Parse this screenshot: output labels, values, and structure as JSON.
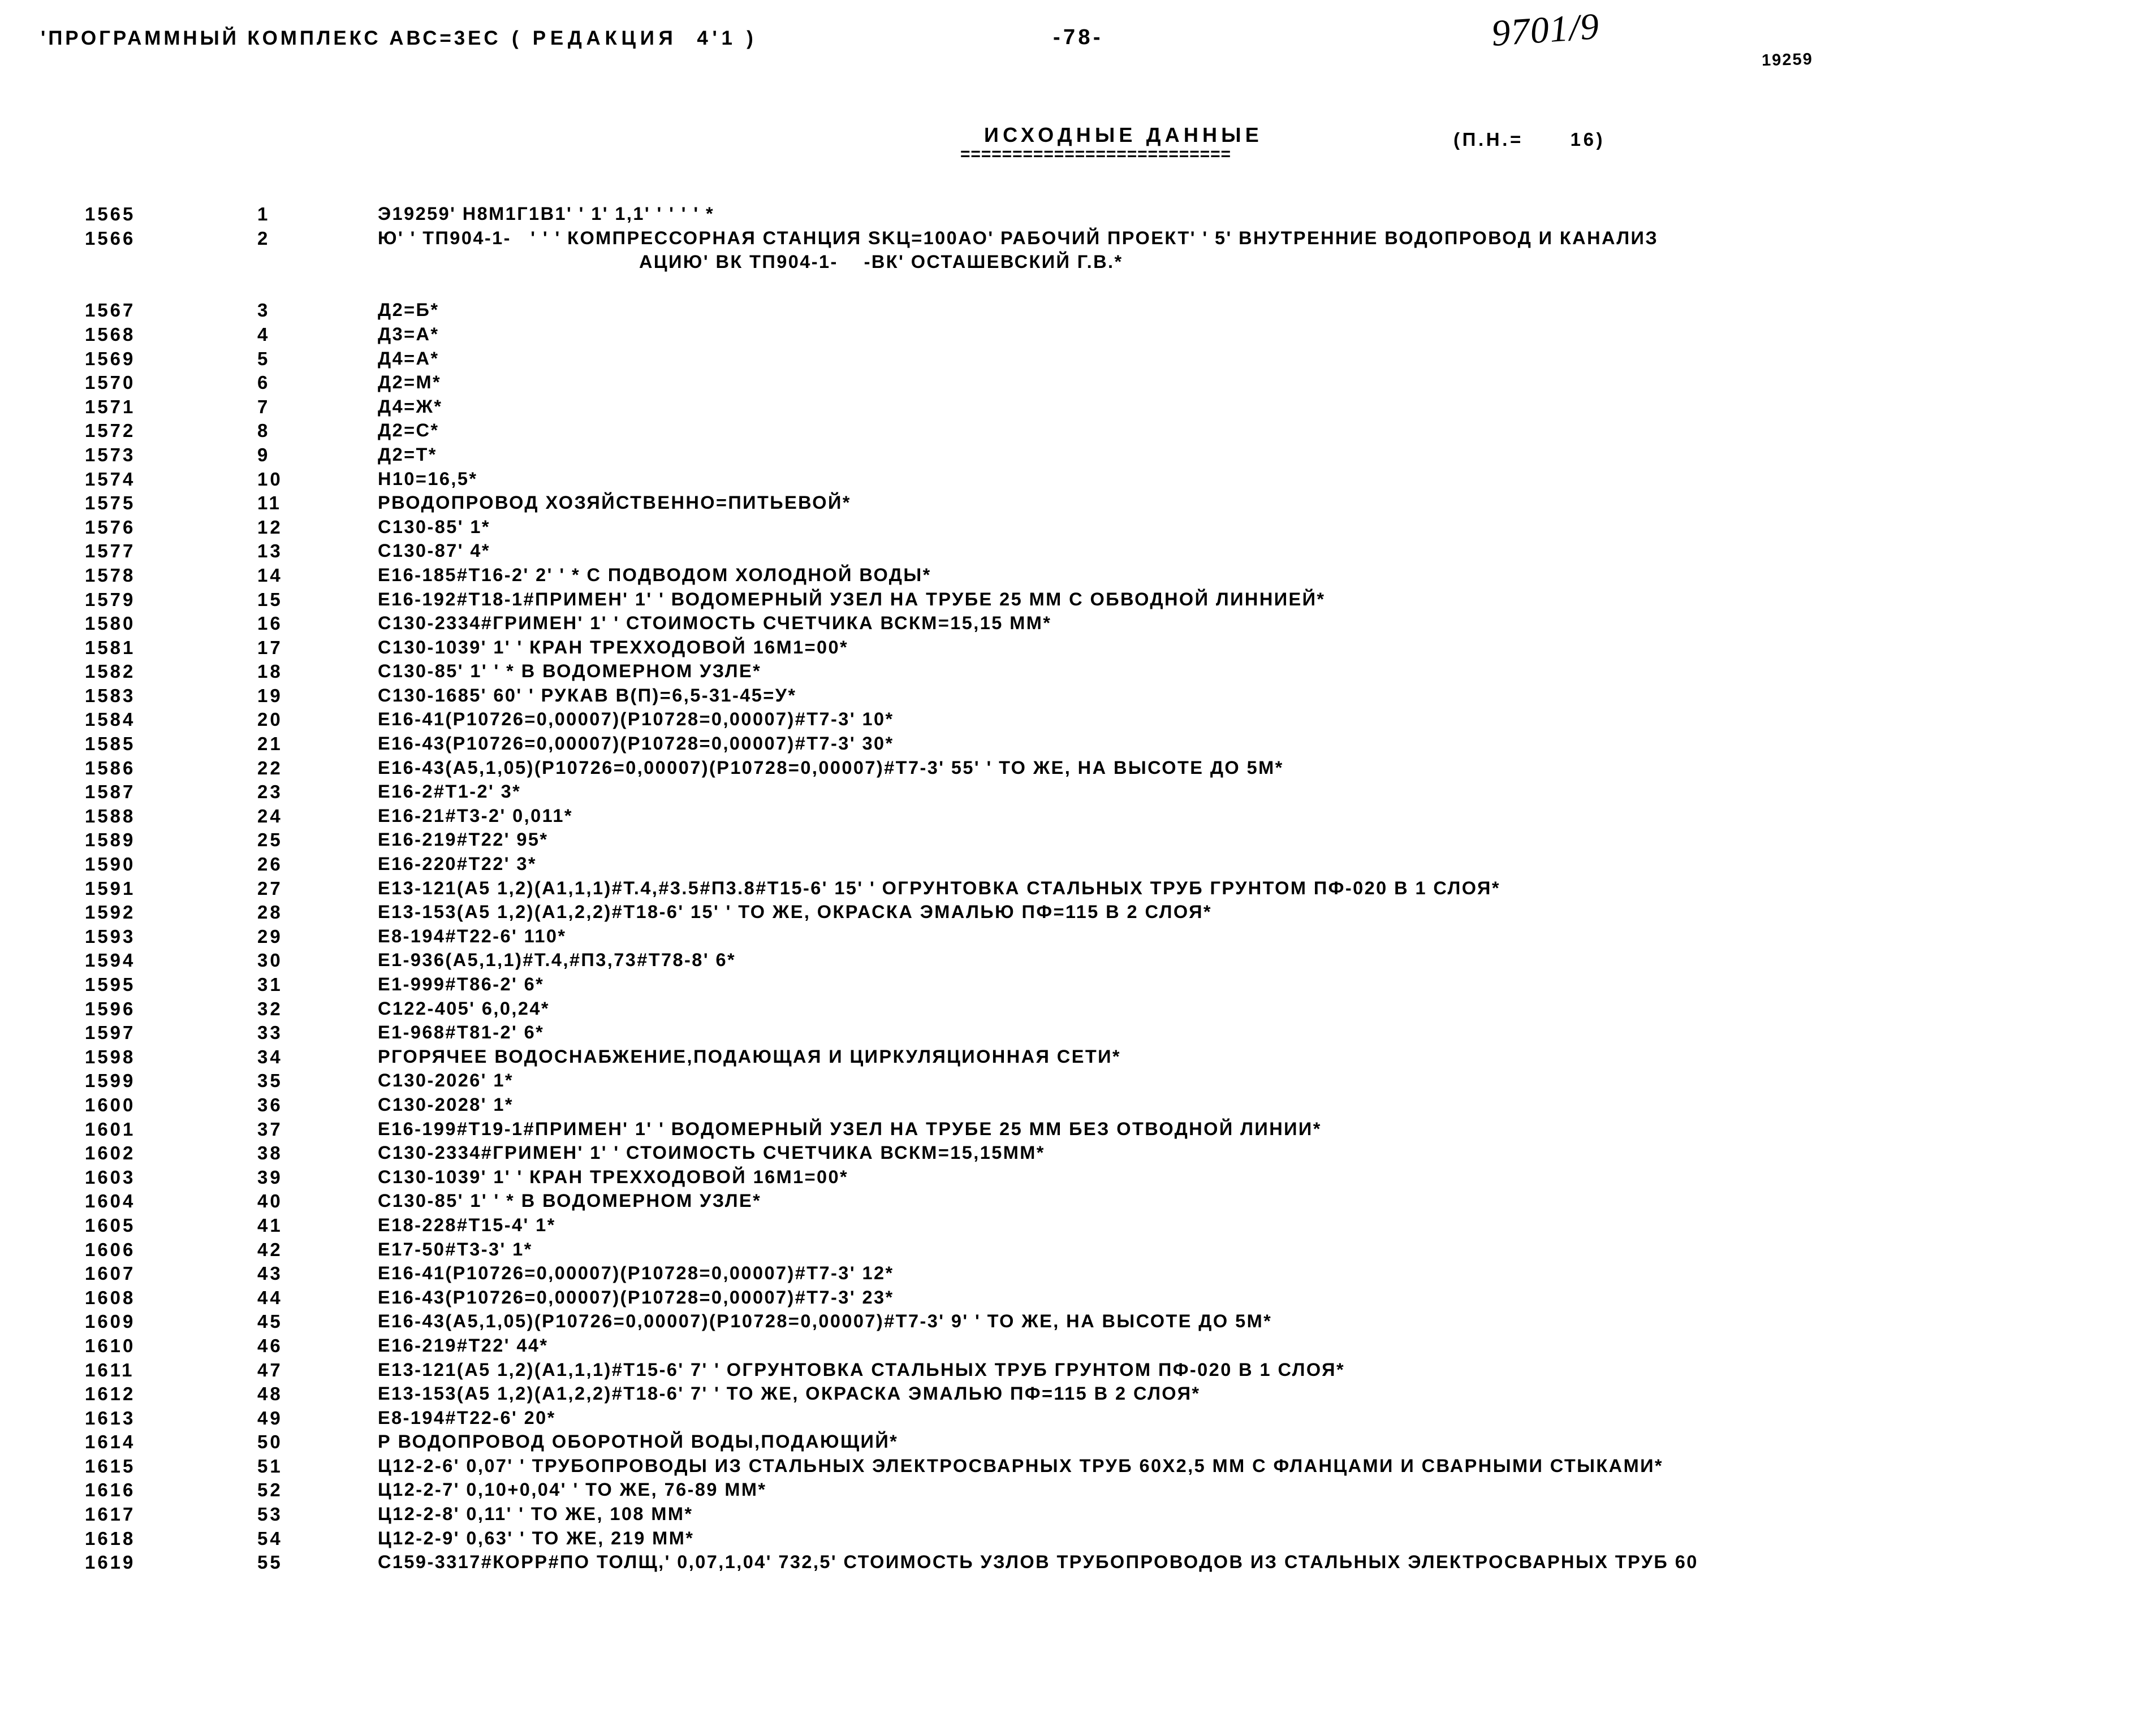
{
  "header": {
    "program_title": "'ПРОГРАММНЫЙ КОМПЛЕКС АВС=3ЕС",
    "revision": "( РЕДАКЦИЯ  4'1 )",
    "page_number": "-78-",
    "order_number": "9701/9",
    "object_stamp": "19259"
  },
  "section": {
    "title": "ИСХОДНЫЕ ДАННЫЕ",
    "rule": "==========================",
    "note": "(П.Н.=      16)"
  },
  "listing": {
    "rows": [
      {
        "recno": "1565",
        "seq": "1",
        "text": "Э19259' Н8М1Г1В1' ' 1' 1,1' ' ' ' ' *",
        "cont": false
      },
      {
        "recno": "1566",
        "seq": "2",
        "text": "Ю' ' ТП904-1-   ' ' ' КОМПРЕССОРНАЯ СТАНЦИЯ SKЦ=100АО' РАБОЧИЙ ПРОЕКТ' ' 5' ВНУТРЕННИЕ ВОДОПРОВОД И КАНАЛИЗ",
        "cont": false
      },
      {
        "recno": "",
        "seq": "",
        "text": "АЦИЮ' ВК ТП904-1-    -ВК' ОСТАШЕВСКИЙ Г.В.*",
        "cont": true
      },
      {
        "recno": "1567",
        "seq": "3",
        "text": "Д2=Б*",
        "cont": false
      },
      {
        "recno": "1568",
        "seq": "4",
        "text": "Д3=А*",
        "cont": false
      },
      {
        "recno": "1569",
        "seq": "5",
        "text": "Д4=А*",
        "cont": false
      },
      {
        "recno": "1570",
        "seq": "6",
        "text": "Д2=М*",
        "cont": false
      },
      {
        "recno": "1571",
        "seq": "7",
        "text": "Д4=Ж*",
        "cont": false
      },
      {
        "recno": "1572",
        "seq": "8",
        "text": "Д2=С*",
        "cont": false
      },
      {
        "recno": "1573",
        "seq": "9",
        "text": "Д2=Т*",
        "cont": false
      },
      {
        "recno": "1574",
        "seq": "10",
        "text": "Н10=16,5*",
        "cont": false
      },
      {
        "recno": "1575",
        "seq": "11",
        "text": "РВОДОПРОВОД ХОЗЯЙСТВЕННО=ПИТЬЕВОЙ*",
        "cont": false
      },
      {
        "recno": "1576",
        "seq": "12",
        "text": "С130-85' 1*",
        "cont": false
      },
      {
        "recno": "1577",
        "seq": "13",
        "text": "С130-87' 4*",
        "cont": false
      },
      {
        "recno": "1578",
        "seq": "14",
        "text": "Е16-185#Т16-2' 2' ' * С ПОДВОДОМ ХОЛОДНОЙ ВОДЫ*",
        "cont": false
      },
      {
        "recno": "1579",
        "seq": "15",
        "text": "Е16-192#Т18-1#ПРИМЕН' 1' ' ВОДОМЕРНЫЙ УЗЕЛ НА ТРУБЕ 25 ММ С ОБВОДНОЙ ЛИННИЕЙ*",
        "cont": false
      },
      {
        "recno": "1580",
        "seq": "16",
        "text": "С130-2334#ГРИМЕН' 1' ' СТОИМОСТЬ СЧЕТЧИКА ВСКМ=15,15 ММ*",
        "cont": false
      },
      {
        "recno": "1581",
        "seq": "17",
        "text": "С130-1039' 1' ' КРАН ТРЕХХОДОВОЙ 16М1=00*",
        "cont": false
      },
      {
        "recno": "1582",
        "seq": "18",
        "text": "С130-85' 1' ' * В ВОДОМЕРНОМ УЗЛЕ*",
        "cont": false
      },
      {
        "recno": "1583",
        "seq": "19",
        "text": "С130-1685' 60' ' РУКАВ В(П)=6,5-31-45=У*",
        "cont": false
      },
      {
        "recno": "1584",
        "seq": "20",
        "text": "Е16-41(Р10726=0,00007)(Р10728=0,00007)#Т7-3' 10*",
        "cont": false
      },
      {
        "recno": "1585",
        "seq": "21",
        "text": "Е16-43(Р10726=0,00007)(Р10728=0,00007)#Т7-3' 30*",
        "cont": false
      },
      {
        "recno": "1586",
        "seq": "22",
        "text": "Е16-43(А5,1,05)(Р10726=0,00007)(Р10728=0,00007)#Т7-3' 55' ' ТО ЖЕ, НА ВЫСОТЕ ДО 5М*",
        "cont": false
      },
      {
        "recno": "1587",
        "seq": "23",
        "text": "Е16-2#Т1-2' 3*",
        "cont": false
      },
      {
        "recno": "1588",
        "seq": "24",
        "text": "Е16-21#Т3-2' 0,011*",
        "cont": false
      },
      {
        "recno": "1589",
        "seq": "25",
        "text": "Е16-219#Т22' 95*",
        "cont": false
      },
      {
        "recno": "1590",
        "seq": "26",
        "text": "Е16-220#Т22' 3*",
        "cont": false
      },
      {
        "recno": "1591",
        "seq": "27",
        "text": "Е13-121(А5 1,2)(А1,1,1)#Т.4,#3.5#П3.8#Т15-6' 15' ' ОГРУНТОВКА СТАЛЬНЫХ ТРУБ ГРУНТОМ ПФ-020 В 1 СЛОЯ*",
        "cont": false
      },
      {
        "recno": "1592",
        "seq": "28",
        "text": "Е13-153(А5 1,2)(А1,2,2)#Т18-6' 15' ' ТО ЖЕ, ОКРАСКА ЭМАЛЬЮ ПФ=115 В 2 СЛОЯ*",
        "cont": false
      },
      {
        "recno": "1593",
        "seq": "29",
        "text": "Е8-194#Т22-6' 110*",
        "cont": false
      },
      {
        "recno": "1594",
        "seq": "30",
        "text": "Е1-936(А5,1,1)#Т.4,#П3,73#Т78-8' 6*",
        "cont": false
      },
      {
        "recno": "1595",
        "seq": "31",
        "text": "Е1-999#Т86-2' 6*",
        "cont": false
      },
      {
        "recno": "1596",
        "seq": "32",
        "text": "С122-405' 6,0,24*",
        "cont": false
      },
      {
        "recno": "1597",
        "seq": "33",
        "text": "Е1-968#Т81-2' 6*",
        "cont": false
      },
      {
        "recno": "1598",
        "seq": "34",
        "text": "РГОРЯЧЕЕ ВОДОСНАБЖЕНИЕ,ПОДАЮЩАЯ И ЦИРКУЛЯЦИОННАЯ СЕТИ*",
        "cont": false
      },
      {
        "recno": "1599",
        "seq": "35",
        "text": "С130-2026' 1*",
        "cont": false
      },
      {
        "recno": "1600",
        "seq": "36",
        "text": "С130-2028' 1*",
        "cont": false
      },
      {
        "recno": "1601",
        "seq": "37",
        "text": "Е16-199#Т19-1#ПРИМЕН' 1' ' ВОДОМЕРНЫЙ УЗЕЛ НА ТРУБЕ 25 ММ БЕЗ ОТВОДНОЙ ЛИНИИ*",
        "cont": false
      },
      {
        "recno": "1602",
        "seq": "38",
        "text": "С130-2334#ГРИМЕН' 1' ' СТОИМОСТЬ СЧЕТЧИКА ВСКМ=15,15ММ*",
        "cont": false
      },
      {
        "recno": "1603",
        "seq": "39",
        "text": "С130-1039' 1' ' КРАН ТРЕХХОДОВОЙ 16М1=00*",
        "cont": false
      },
      {
        "recno": "1604",
        "seq": "40",
        "text": "С130-85' 1' ' * В ВОДОМЕРНОМ УЗЛЕ*",
        "cont": false
      },
      {
        "recno": "1605",
        "seq": "41",
        "text": "Е18-228#Т15-4' 1*",
        "cont": false
      },
      {
        "recno": "1606",
        "seq": "42",
        "text": "Е17-50#Т3-3' 1*",
        "cont": false
      },
      {
        "recno": "1607",
        "seq": "43",
        "text": "Е16-41(Р10726=0,00007)(Р10728=0,00007)#Т7-3' 12*",
        "cont": false
      },
      {
        "recno": "1608",
        "seq": "44",
        "text": "Е16-43(Р10726=0,00007)(Р10728=0,00007)#Т7-3' 23*",
        "cont": false
      },
      {
        "recno": "1609",
        "seq": "45",
        "text": "Е16-43(А5,1,05)(Р10726=0,00007)(Р10728=0,00007)#Т7-3' 9' ' ТО ЖЕ, НА ВЫСОТЕ ДО 5М*",
        "cont": false
      },
      {
        "recno": "1610",
        "seq": "46",
        "text": "Е16-219#Т22' 44*",
        "cont": false
      },
      {
        "recno": "1611",
        "seq": "47",
        "text": "Е13-121(А5 1,2)(А1,1,1)#Т15-6' 7' ' ОГРУНТОВКА СТАЛЬНЫХ ТРУБ ГРУНТОМ ПФ-020 В 1 СЛОЯ*",
        "cont": false
      },
      {
        "recno": "1612",
        "seq": "48",
        "text": "Е13-153(А5 1,2)(А1,2,2)#Т18-6' 7' ' ТО ЖЕ, ОКРАСКА ЭМАЛЬЮ ПФ=115 В 2 СЛОЯ*",
        "cont": false
      },
      {
        "recno": "1613",
        "seq": "49",
        "text": "Е8-194#Т22-6' 20*",
        "cont": false
      },
      {
        "recno": "1614",
        "seq": "50",
        "text": "Р ВОДОПРОВОД ОБОРОТНОЙ ВОДЫ,ПОДАЮЩИЙ*",
        "cont": false
      },
      {
        "recno": "1615",
        "seq": "51",
        "text": "Ц12-2-6' 0,07' ' ТРУБОПРОВОДЫ ИЗ СТАЛЬНЫХ ЭЛЕКТРОСВАРНЫХ ТРУБ 60Х2,5 ММ С ФЛАНЦАМИ И СВАРНЫМИ СТЫКАМИ*",
        "cont": false
      },
      {
        "recno": "1616",
        "seq": "52",
        "text": "Ц12-2-7' 0,10+0,04' ' ТО ЖЕ, 76-89 ММ*",
        "cont": false
      },
      {
        "recno": "1617",
        "seq": "53",
        "text": "Ц12-2-8' 0,11' ' ТО ЖЕ, 108 ММ*",
        "cont": false
      },
      {
        "recno": "1618",
        "seq": "54",
        "text": "Ц12-2-9' 0,63' ' ТО ЖЕ, 219 ММ*",
        "cont": false
      },
      {
        "recno": "1619",
        "seq": "55",
        "text": "С159-3317#КОРР#ПО ТОЛЩ,' 0,07,1,04' 732,5' СТОИМОСТЬ УЗЛОВ ТРУБОПРОВОДОВ ИЗ СТАЛЬНЫХ ЭЛЕКТРОСВАРНЫХ ТРУБ 60",
        "cont": false
      }
    ]
  }
}
